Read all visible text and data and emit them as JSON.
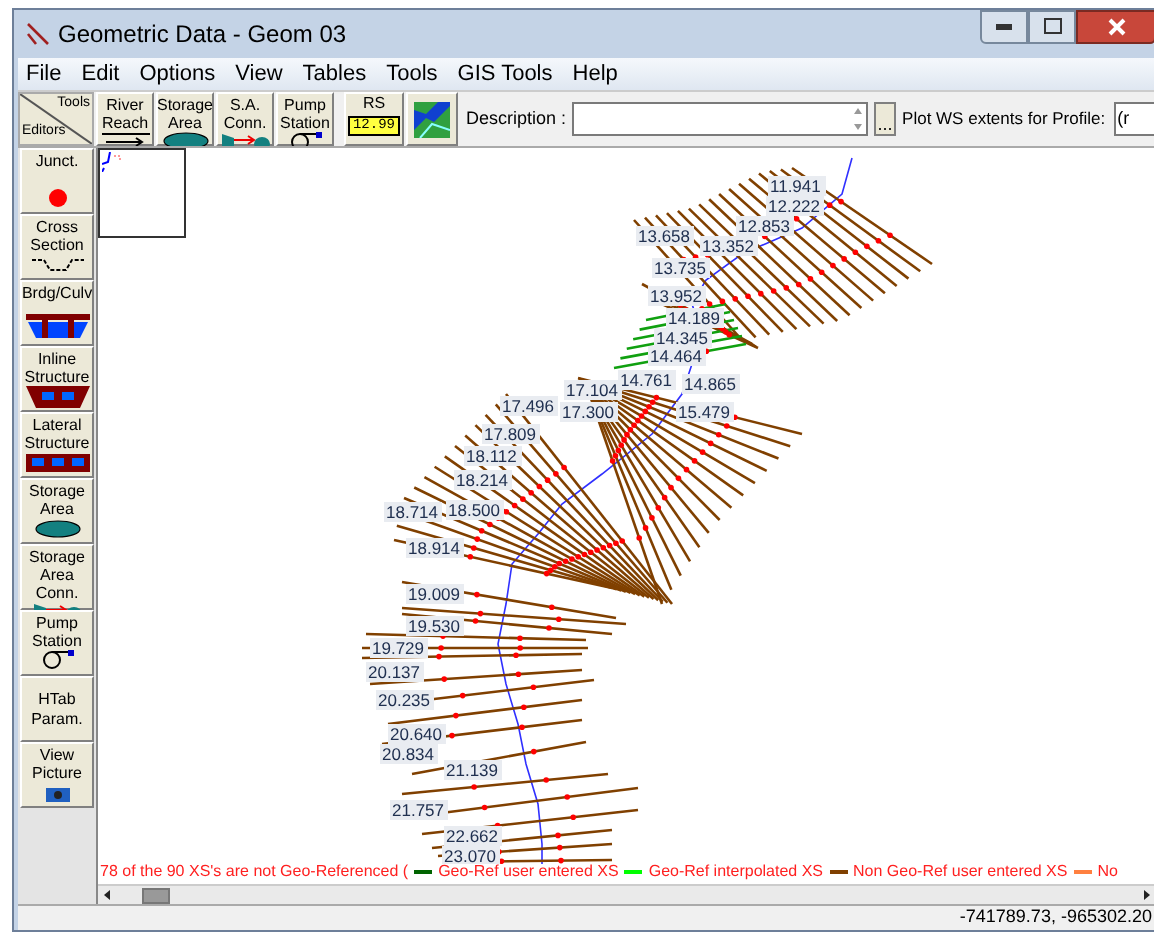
{
  "window": {
    "title": "Geometric Data - Geom 03"
  },
  "menu": [
    "File",
    "Edit",
    "Options",
    "View",
    "Tables",
    "Tools",
    "GIS Tools",
    "Help"
  ],
  "toolbar": {
    "corner_top": "Tools",
    "corner_bottom": "Editors",
    "tools": [
      {
        "label": "River Reach",
        "kind": "reach"
      },
      {
        "label": "Storage Area",
        "kind": "storage"
      },
      {
        "label": "S.A. Conn.",
        "kind": "conn"
      },
      {
        "label": "Pump Station",
        "kind": "pump"
      }
    ],
    "rs_button": {
      "label": "RS",
      "tag": "12.99"
    },
    "description_label": "Description :",
    "more_button": "...",
    "profile_label": "Plot WS extents for Profile:",
    "profile_value": "(r"
  },
  "editors": [
    {
      "label": "Junct.",
      "kind": "junction"
    },
    {
      "label": "Cross Section",
      "kind": "xs"
    },
    {
      "label": "Brdg/Culv",
      "kind": "bridge"
    },
    {
      "label": "Inline Structure",
      "kind": "inline"
    },
    {
      "label": "Lateral Structure",
      "kind": "lateral"
    },
    {
      "label": "Storage Area",
      "kind": "storage"
    },
    {
      "label": "Storage Area Conn.",
      "kind": "conn"
    },
    {
      "label": "Pump Station",
      "kind": "pump"
    },
    {
      "label": "HTab Param.",
      "kind": "text"
    },
    {
      "label": "View Picture",
      "kind": "camera"
    }
  ],
  "canvas": {
    "stations": [
      "11.941",
      "12.222",
      "12.853",
      "13.658",
      "13.352",
      "13.735",
      "13.952",
      "14.189",
      "14.345",
      "14.464",
      "14.761",
      "14.865",
      "15.479",
      "17.104",
      "17.496",
      "17.300",
      "17.809",
      "18.112",
      "18.214",
      "18.714",
      "18.500",
      "18.914",
      "19.009",
      "19.530",
      "19.729",
      "20.137",
      "20.235",
      "20.640",
      "20.834",
      "21.139",
      "21.757",
      "22.662",
      "23.070"
    ],
    "legend": {
      "note": "78 of the 90 XS's are not Geo-Referenced (",
      "items": [
        {
          "label": "Geo-Ref user entered XS",
          "color": "#006400"
        },
        {
          "label": "Geo-Ref interpolated XS",
          "color": "#00ff00"
        },
        {
          "label": "Non Geo-Ref user entered XS",
          "color": "#804000"
        },
        {
          "label": "No",
          "color": "#ff8040"
        }
      ]
    }
  },
  "status_bar": {
    "coordinates": "-741789.73, -965302.20"
  }
}
